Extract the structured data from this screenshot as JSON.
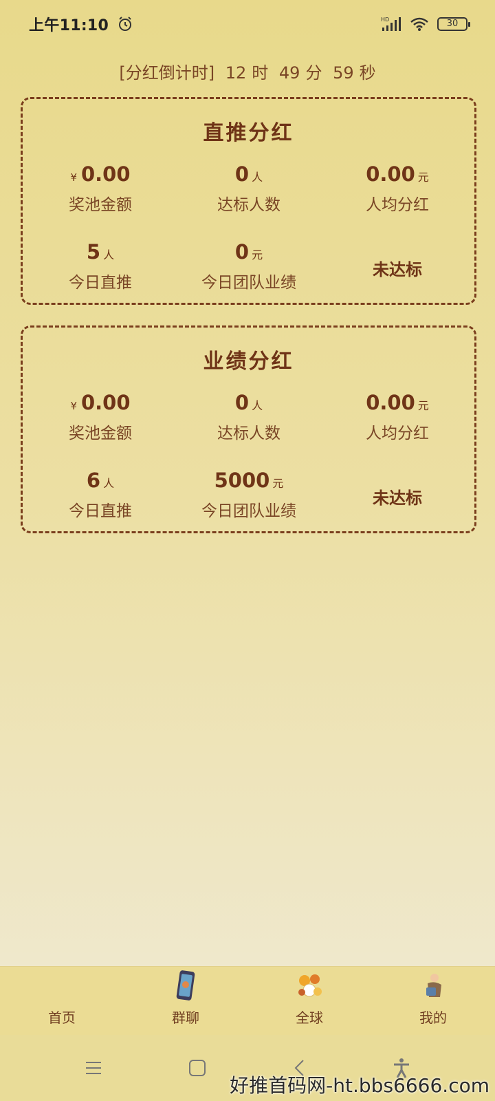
{
  "status_bar": {
    "time": "上午11:10",
    "network": "HD",
    "battery": "30"
  },
  "countdown": {
    "label": "[分红倒计时]",
    "hours": "12",
    "h_unit": "时",
    "minutes": "49",
    "m_unit": "分",
    "seconds": "59",
    "s_unit": "秒"
  },
  "cards": [
    {
      "title": "直推分红",
      "pool": {
        "currency": "¥",
        "value": "0.00",
        "label": "奖池金额"
      },
      "qualified": {
        "value": "0",
        "unit": "人",
        "label": "达标人数"
      },
      "per_person": {
        "value": "0.00",
        "unit": "元",
        "label": "人均分红"
      },
      "today_direct": {
        "value": "5",
        "unit": "人",
        "label": "今日直推"
      },
      "team_perf": {
        "value": "0",
        "unit": "元",
        "label": "今日团队业绩"
      },
      "status": "未达标"
    },
    {
      "title": "业绩分红",
      "pool": {
        "currency": "¥",
        "value": "0.00",
        "label": "奖池金额"
      },
      "qualified": {
        "value": "0",
        "unit": "人",
        "label": "达标人数"
      },
      "per_person": {
        "value": "0.00",
        "unit": "元",
        "label": "人均分红"
      },
      "today_direct": {
        "value": "6",
        "unit": "人",
        "label": "今日直推"
      },
      "team_perf": {
        "value": "5000",
        "unit": "元",
        "label": "今日团队业绩"
      },
      "status": "未达标"
    }
  ],
  "nav": [
    {
      "label": "首页",
      "icon": "home-icon"
    },
    {
      "label": "群聊",
      "icon": "group-chat-icon"
    },
    {
      "label": "全球",
      "icon": "global-icon"
    },
    {
      "label": "我的",
      "icon": "profile-icon"
    }
  ],
  "watermark": "好推首码网-ht.bbs6666.com",
  "colors": {
    "accent": "#6f3417",
    "background_top": "#e8d98b",
    "background_bottom": "#efe8cc"
  }
}
